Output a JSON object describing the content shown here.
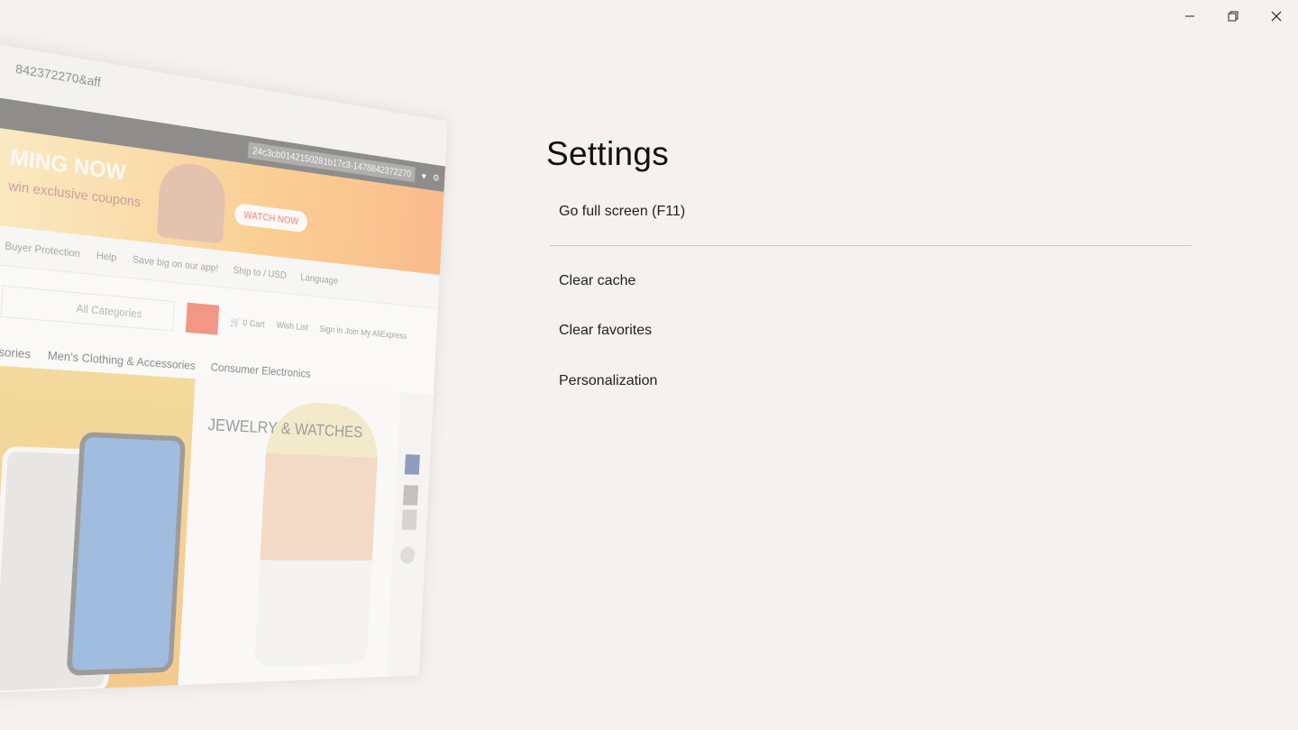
{
  "window": {
    "controls": {
      "minimize": "minimize-icon",
      "restore": "restore-icon",
      "close": "close-icon"
    }
  },
  "preview": {
    "url": "842372270&aff",
    "code": "24c3cb0142150281b17c3-1478842372270",
    "banner_big": "MING NOW",
    "banner_small": "win exclusive coupons",
    "banner_button": "WATCH NOW",
    "nav": [
      "Buyer Protection",
      "Help",
      "Save big on our app!",
      "Ship to / USD",
      "Language"
    ],
    "search_placeholder": "All Categories",
    "cart": "Cart",
    "cart_count": "0",
    "wish": "Wish List",
    "signin": "Sign in",
    "join": "Join",
    "my": "My AliExpress",
    "cats": [
      "sories",
      "Men's Clothing & Accessories",
      "Consumer Electronics"
    ],
    "jewel_title": "JEWELRY & WATCHES"
  },
  "settings": {
    "title": "Settings",
    "items": [
      {
        "label": "Go full screen (F11)"
      },
      {
        "label": "Clear cache"
      },
      {
        "label": "Clear favorites"
      },
      {
        "label": "Personalization"
      }
    ]
  }
}
